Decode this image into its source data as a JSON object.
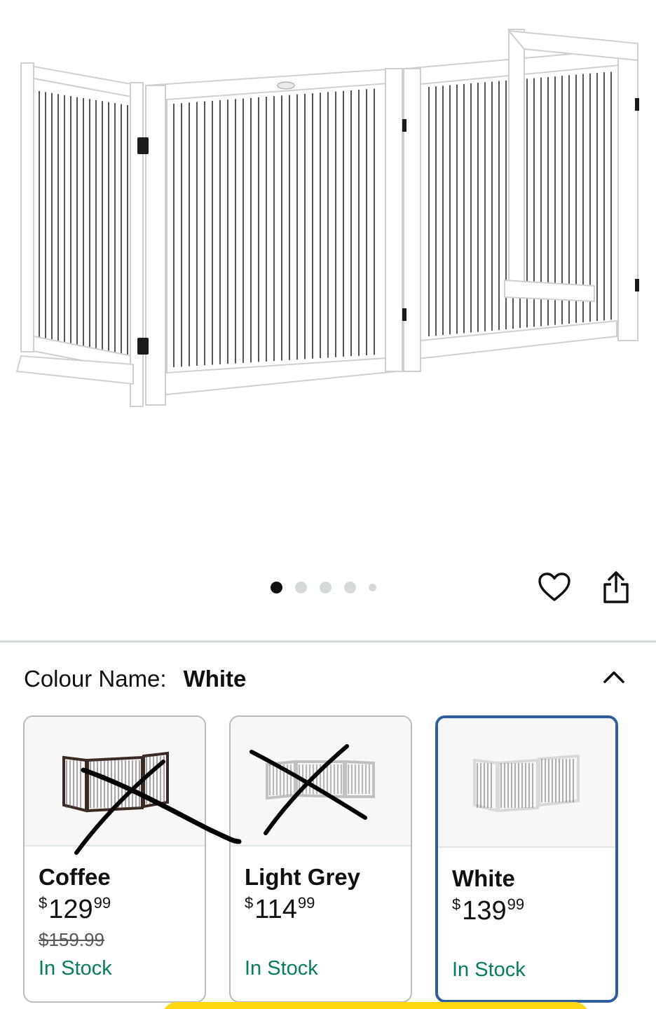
{
  "gallery": {
    "dots": [
      true,
      false,
      false,
      false,
      false
    ],
    "favorite_icon": "heart-outline-icon",
    "share_icon": "share-icon"
  },
  "variation": {
    "label": "Colour Name:",
    "selected": "White",
    "collapse_icon": "chevron-up-icon"
  },
  "options": [
    {
      "name": "Coffee",
      "currency": "$",
      "whole": "129",
      "fraction": "99",
      "was": "$159.99",
      "stock": "In Stock",
      "frame_color": "#3b2a23"
    },
    {
      "name": "Light Grey",
      "currency": "$",
      "whole": "114",
      "fraction": "99",
      "was": "",
      "stock": "In Stock",
      "frame_color": "#bfc1c0"
    },
    {
      "name": "White",
      "currency": "$",
      "whole": "139",
      "fraction": "99",
      "was": "",
      "stock": "In Stock",
      "frame_color": "#ffffff"
    }
  ],
  "colors": {
    "accent_selected": "#2e5e9c",
    "in_stock": "#067d62",
    "buy_button": "#ffd814"
  }
}
